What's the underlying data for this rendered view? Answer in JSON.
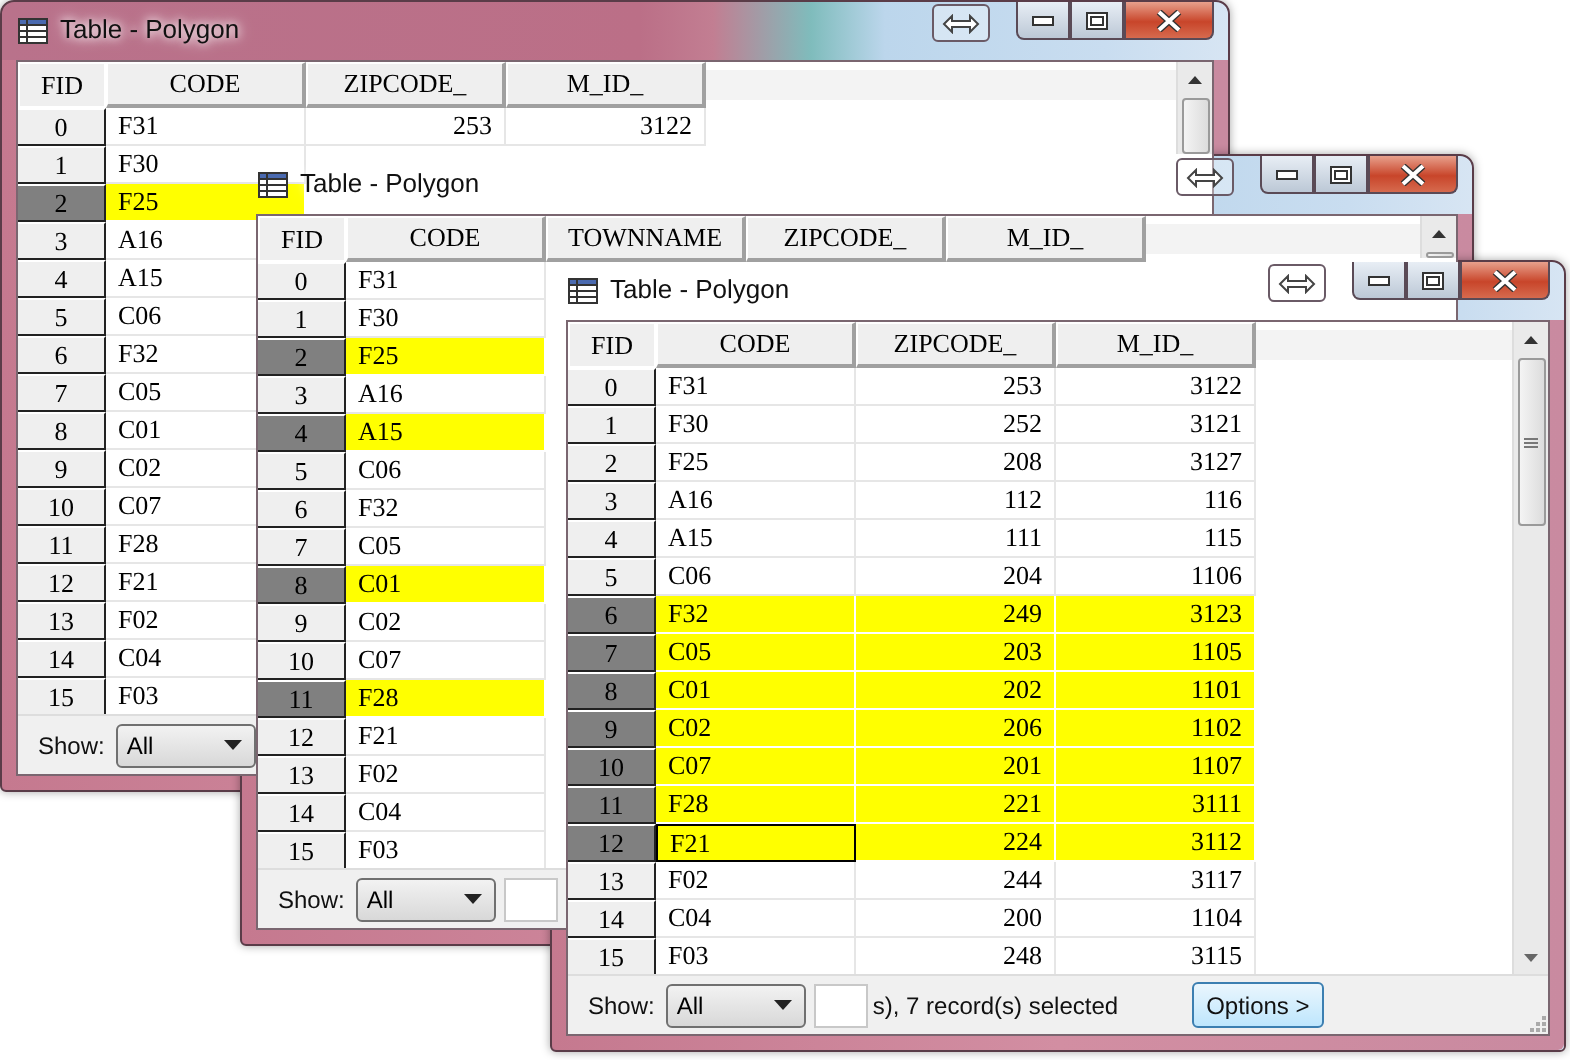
{
  "windows": [
    {
      "title": "Table - Polygon",
      "columns": [
        "FID",
        "CODE",
        "ZIPCODE_",
        "M_ID_"
      ],
      "rows": [
        {
          "fid": "0",
          "selected": false,
          "cells": [
            "F31",
            "253",
            "3122"
          ]
        },
        {
          "fid": "1",
          "selected": false,
          "cells": [
            "F30"
          ]
        },
        {
          "fid": "2",
          "selected": true,
          "cells": [
            "F25"
          ]
        },
        {
          "fid": "3",
          "selected": false,
          "cells": [
            "A16"
          ]
        },
        {
          "fid": "4",
          "selected": false,
          "cells": [
            "A15"
          ]
        },
        {
          "fid": "5",
          "selected": false,
          "cells": [
            "C06"
          ]
        },
        {
          "fid": "6",
          "selected": false,
          "cells": [
            "F32"
          ]
        },
        {
          "fid": "7",
          "selected": false,
          "cells": [
            "C05"
          ]
        },
        {
          "fid": "8",
          "selected": false,
          "cells": [
            "C01"
          ]
        },
        {
          "fid": "9",
          "selected": false,
          "cells": [
            "C02"
          ]
        },
        {
          "fid": "10",
          "selected": false,
          "cells": [
            "C07"
          ]
        },
        {
          "fid": "11",
          "selected": false,
          "cells": [
            "F28"
          ]
        },
        {
          "fid": "12",
          "selected": false,
          "cells": [
            "F21"
          ]
        },
        {
          "fid": "13",
          "selected": false,
          "cells": [
            "F02"
          ]
        },
        {
          "fid": "14",
          "selected": false,
          "cells": [
            "C04"
          ]
        },
        {
          "fid": "15",
          "selected": false,
          "cells": [
            "F03"
          ]
        }
      ],
      "footer": {
        "show_label": "Show:",
        "show_value": "All"
      }
    },
    {
      "title": "Table - Polygon",
      "columns": [
        "FID",
        "CODE",
        "TOWNNAME",
        "ZIPCODE_",
        "M_ID_"
      ],
      "rows": [
        {
          "fid": "0",
          "selected": false,
          "cells": [
            "F31"
          ]
        },
        {
          "fid": "1",
          "selected": false,
          "cells": [
            "F30"
          ]
        },
        {
          "fid": "2",
          "selected": true,
          "cells": [
            "F25"
          ]
        },
        {
          "fid": "3",
          "selected": false,
          "cells": [
            "A16"
          ]
        },
        {
          "fid": "4",
          "selected": true,
          "cells": [
            "A15"
          ]
        },
        {
          "fid": "5",
          "selected": false,
          "cells": [
            "C06"
          ]
        },
        {
          "fid": "6",
          "selected": false,
          "cells": [
            "F32"
          ]
        },
        {
          "fid": "7",
          "selected": false,
          "cells": [
            "C05"
          ]
        },
        {
          "fid": "8",
          "selected": true,
          "cells": [
            "C01"
          ]
        },
        {
          "fid": "9",
          "selected": false,
          "cells": [
            "C02"
          ]
        },
        {
          "fid": "10",
          "selected": false,
          "cells": [
            "C07"
          ]
        },
        {
          "fid": "11",
          "selected": true,
          "cells": [
            "F28"
          ]
        },
        {
          "fid": "12",
          "selected": false,
          "cells": [
            "F21"
          ]
        },
        {
          "fid": "13",
          "selected": false,
          "cells": [
            "F02"
          ]
        },
        {
          "fid": "14",
          "selected": false,
          "cells": [
            "C04"
          ]
        },
        {
          "fid": "15",
          "selected": false,
          "cells": [
            "F03"
          ]
        }
      ],
      "footer": {
        "show_label": "Show:",
        "show_value": "All"
      }
    },
    {
      "title": "Table - Polygon",
      "columns": [
        "FID",
        "CODE",
        "ZIPCODE_",
        "M_ID_"
      ],
      "rows": [
        {
          "fid": "0",
          "selected": false,
          "focused": false,
          "cells": [
            "F31",
            "253",
            "3122"
          ]
        },
        {
          "fid": "1",
          "selected": false,
          "focused": false,
          "cells": [
            "F30",
            "252",
            "3121"
          ]
        },
        {
          "fid": "2",
          "selected": false,
          "focused": false,
          "cells": [
            "F25",
            "208",
            "3127"
          ]
        },
        {
          "fid": "3",
          "selected": false,
          "focused": false,
          "cells": [
            "A16",
            "112",
            "116"
          ]
        },
        {
          "fid": "4",
          "selected": false,
          "focused": false,
          "cells": [
            "A15",
            "111",
            "115"
          ]
        },
        {
          "fid": "5",
          "selected": false,
          "focused": false,
          "cells": [
            "C06",
            "204",
            "1106"
          ]
        },
        {
          "fid": "6",
          "selected": true,
          "focused": false,
          "cells": [
            "F32",
            "249",
            "3123"
          ]
        },
        {
          "fid": "7",
          "selected": true,
          "focused": false,
          "cells": [
            "C05",
            "203",
            "1105"
          ]
        },
        {
          "fid": "8",
          "selected": true,
          "focused": false,
          "cells": [
            "C01",
            "202",
            "1101"
          ]
        },
        {
          "fid": "9",
          "selected": true,
          "focused": false,
          "cells": [
            "C02",
            "206",
            "1102"
          ]
        },
        {
          "fid": "10",
          "selected": true,
          "focused": false,
          "cells": [
            "C07",
            "201",
            "1107"
          ]
        },
        {
          "fid": "11",
          "selected": true,
          "focused": false,
          "cells": [
            "F28",
            "221",
            "3111"
          ]
        },
        {
          "fid": "12",
          "selected": true,
          "focused": true,
          "cells": [
            "F21",
            "224",
            "3112"
          ]
        },
        {
          "fid": "13",
          "selected": false,
          "focused": false,
          "cells": [
            "F02",
            "244",
            "3117"
          ]
        },
        {
          "fid": "14",
          "selected": false,
          "focused": false,
          "cells": [
            "C04",
            "200",
            "1104"
          ]
        },
        {
          "fid": "15",
          "selected": false,
          "focused": false,
          "cells": [
            "F03",
            "248",
            "3115"
          ]
        }
      ],
      "footer": {
        "show_label": "Show:",
        "show_value": "All",
        "status": "s), 7 record(s) selected",
        "options_button": "Options >"
      }
    }
  ]
}
